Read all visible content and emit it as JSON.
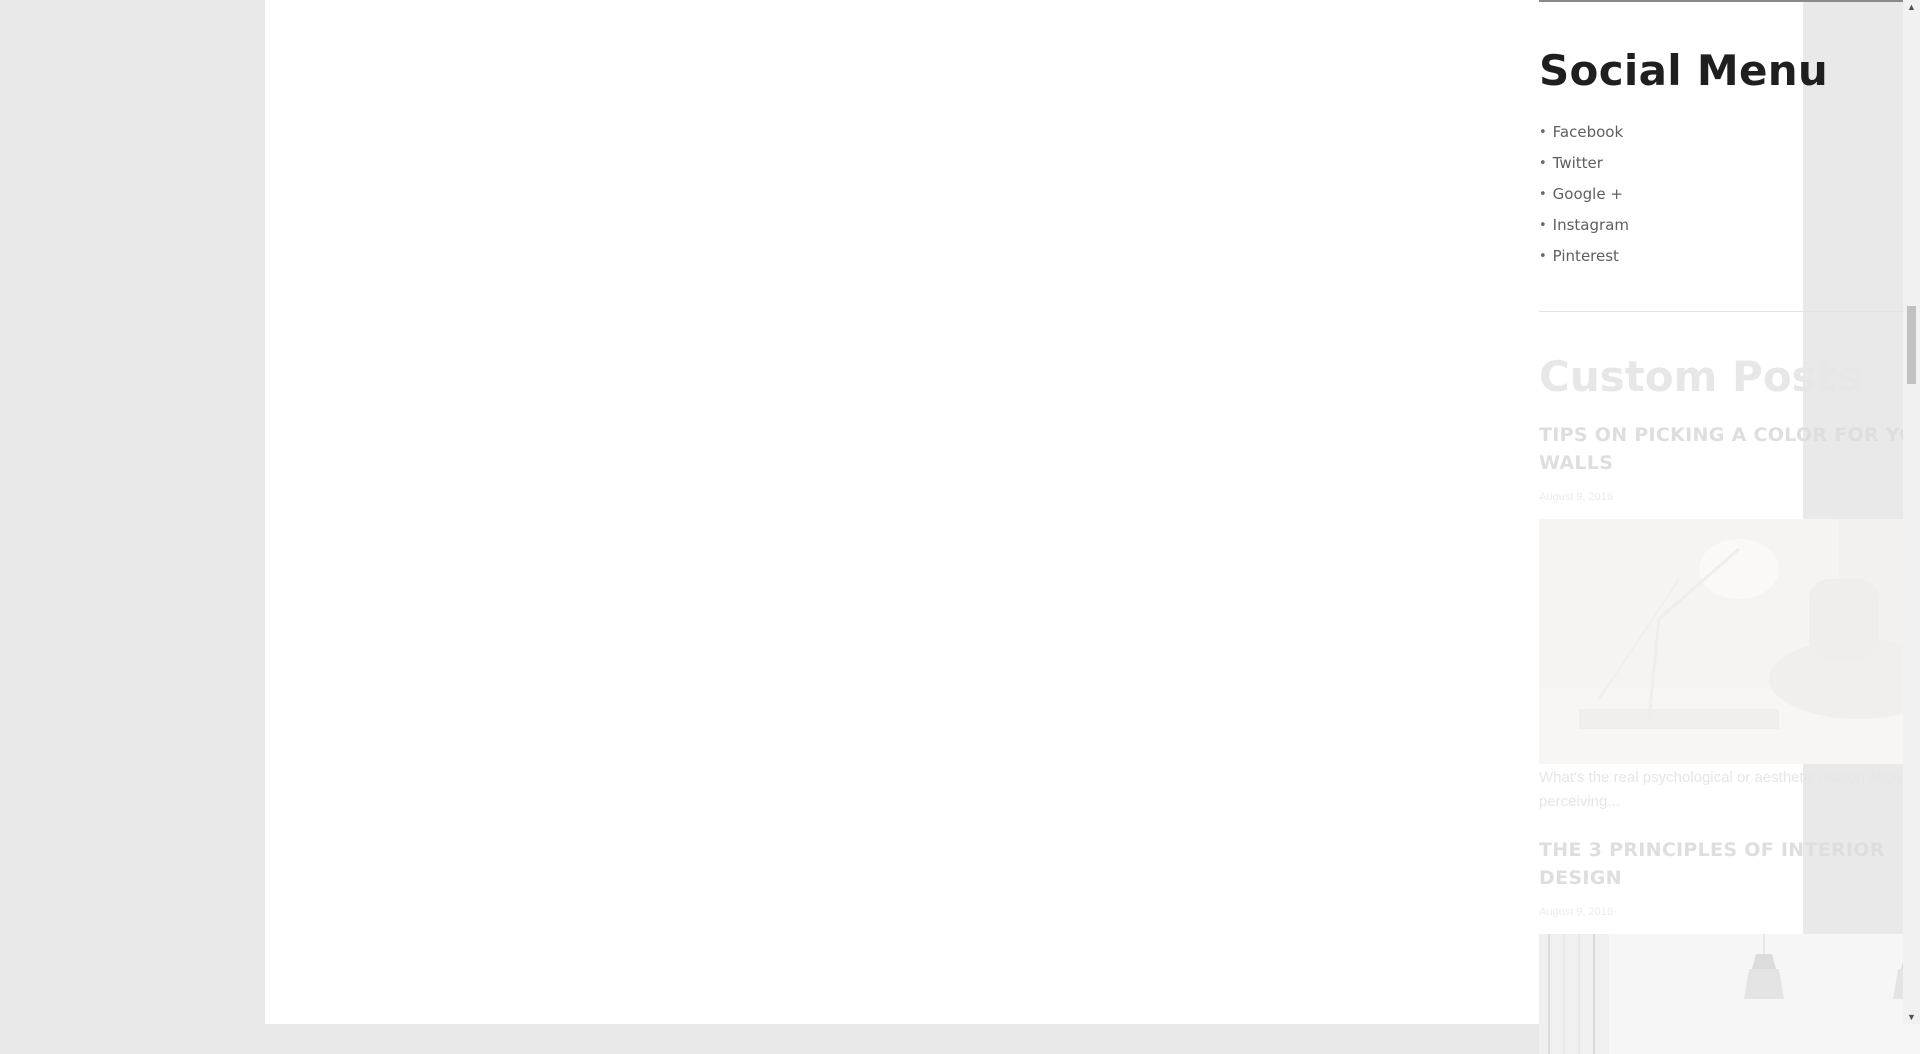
{
  "sidebar": {
    "social_menu": {
      "title": "Social Menu",
      "items": [
        {
          "label": "Facebook"
        },
        {
          "label": "Twitter"
        },
        {
          "label": "Google +"
        },
        {
          "label": "Instagram"
        },
        {
          "label": "Pinterest"
        }
      ]
    },
    "custom_posts": {
      "title": "Custom Posts",
      "posts": [
        {
          "title": "TIPS ON PICKING A COLOR FOR YOUR WALLS",
          "date": "August 9, 2016",
          "excerpt": "What's the real psychological or aesthetic reason about people perceiving..."
        },
        {
          "title": "THE 3 PRINCIPLES OF INTERIOR DESIGN",
          "date": "August 9, 2016"
        }
      ]
    }
  },
  "scrollbar": {
    "position": 0.3
  },
  "colors": {
    "page_background": "#e9e9e9",
    "content_background": "#ffffff",
    "heading": "#1f1f1f",
    "menu_text": "#5f5f5f"
  }
}
